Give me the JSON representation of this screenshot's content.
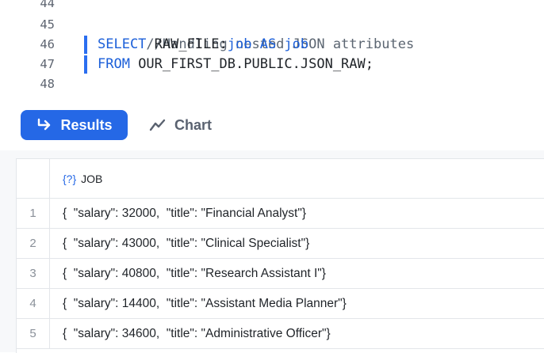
{
  "editor": {
    "lines": [
      {
        "number": "44",
        "has_marker": false,
        "tokens": []
      },
      {
        "number": "45",
        "has_marker": false,
        "tokens": [
          {
            "type": "comment",
            "text": "//Handling nested JSON attributes"
          }
        ]
      },
      {
        "number": "46",
        "has_marker": true,
        "tokens": [
          {
            "type": "kw",
            "text": "SELECT"
          },
          {
            "type": "id",
            "text": " RAW_FILE:"
          },
          {
            "type": "kw",
            "text": "job AS job"
          }
        ]
      },
      {
        "number": "47",
        "has_marker": true,
        "tokens": [
          {
            "type": "kw",
            "text": "FROM"
          },
          {
            "type": "id",
            "text": " OUR_FIRST_DB.PUBLIC.JSON_RAW;"
          }
        ]
      },
      {
        "number": "48",
        "has_marker": false,
        "tokens": []
      }
    ]
  },
  "toolbar": {
    "results_label": "Results",
    "results_icon": "return-arrow-icon",
    "chart_label": "Chart",
    "chart_icon": "line-chart-icon"
  },
  "results": {
    "columns": [
      {
        "type_icon": "{?}",
        "name": "JOB"
      }
    ],
    "rows": [
      {
        "index": "1",
        "value": "{  \"salary\": 32000,  \"title\": \"Financial Analyst\"}"
      },
      {
        "index": "2",
        "value": "{  \"salary\": 43000,  \"title\": \"Clinical Specialist\"}"
      },
      {
        "index": "3",
        "value": "{  \"salary\": 40800,  \"title\": \"Research Assistant I\"}"
      },
      {
        "index": "4",
        "value": "{  \"salary\": 14400,  \"title\": \"Assistant Media Planner\"}"
      },
      {
        "index": "5",
        "value": "{  \"salary\": 34600,  \"title\": \"Administrative Officer\"}"
      }
    ]
  },
  "colors": {
    "accent": "#2568e6",
    "keyword": "#1b5fd9",
    "comment": "#5c6672"
  }
}
